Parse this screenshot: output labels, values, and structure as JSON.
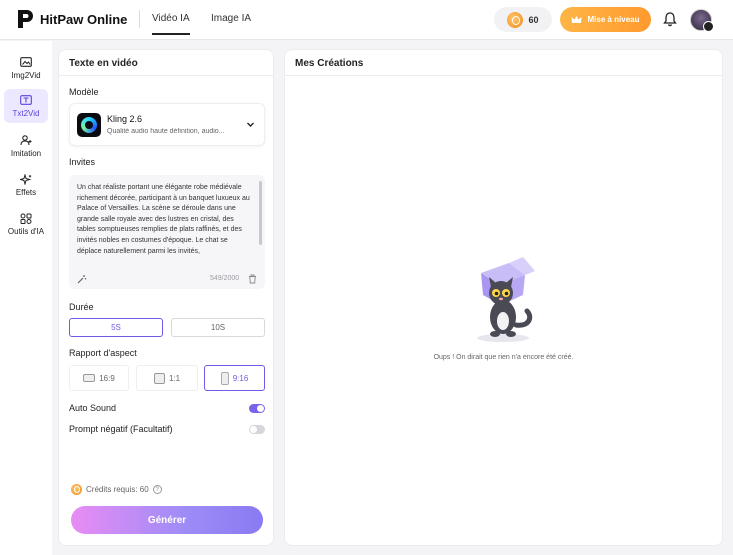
{
  "app": {
    "name": "HitPaw Online"
  },
  "nav": {
    "tabs": [
      {
        "label": "Vidéo IA",
        "active": true
      },
      {
        "label": "Image IA",
        "active": false
      }
    ]
  },
  "header": {
    "credits": "60",
    "upgrade_label": "Mise à niveau"
  },
  "sidebar": {
    "items": [
      {
        "label": "Img2Vid",
        "icon": "image-video-icon",
        "active": false
      },
      {
        "label": "Txt2Vid",
        "icon": "text-video-icon",
        "active": true
      },
      {
        "label": "Imitation",
        "icon": "person-imitation-icon",
        "active": false
      },
      {
        "label": "Effets",
        "icon": "sparkle-icon",
        "active": false
      },
      {
        "label": "Outils d'IA",
        "icon": "tools-grid-icon",
        "active": false
      }
    ]
  },
  "form": {
    "title": "Texte en vidéo",
    "model_label": "Modèle",
    "model": {
      "name": "Kling 2.6",
      "description": "Qualité audio haute définition, audio..."
    },
    "prompt_label": "Invites",
    "prompt_text": "Un chat réaliste portant une élégante robe médiévale richement décorée, participant à un banquet luxueux au Palace of Versailles. La scène se déroule dans une grande salle royale avec des lustres en cristal, des tables somptueuses remplies de plats raffinés, et des invités nobles en costumes d'époque. Le chat se déplace naturellement parmi les invités,",
    "prompt_counter": "549/2000",
    "duration_label": "Durée",
    "durations": [
      {
        "label": "5S",
        "selected": true
      },
      {
        "label": "10S",
        "selected": false
      }
    ],
    "aspect_label": "Rapport d'aspect",
    "aspects": [
      {
        "label": "16:9",
        "selected": false
      },
      {
        "label": "1:1",
        "selected": false
      },
      {
        "label": "9:16",
        "selected": true
      }
    ],
    "auto_sound_label": "Auto Sound",
    "auto_sound_on": true,
    "negative_prompt_label": "Prompt négatif (Facultatif)",
    "negative_prompt_on": false,
    "credits_required": "Crédits requis: 60",
    "generate_label": "Générer"
  },
  "creations": {
    "title": "Mes Créations",
    "empty_message": "Oups ! On dirait que rien n'a encore été créé."
  },
  "colors": {
    "accent": "#6e5ce6",
    "upgrade": "#ffa63a",
    "toggle_on": "#7b62ea"
  }
}
